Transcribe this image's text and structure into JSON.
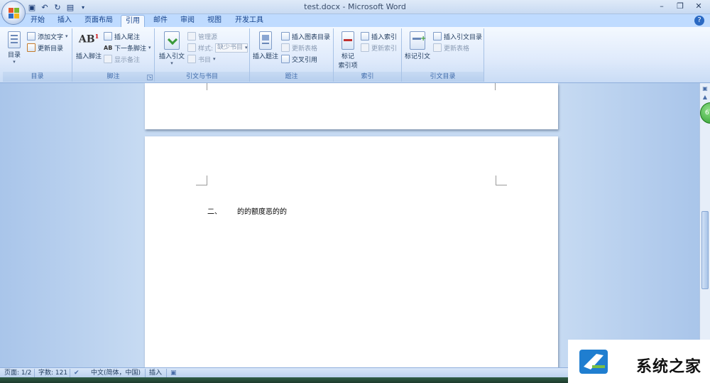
{
  "window": {
    "title": "test.docx - Microsoft Word"
  },
  "quick_access": [
    "save-icon",
    "undo-icon",
    "redo-icon",
    "print-preview-icon"
  ],
  "tabs": [
    {
      "label": "开始"
    },
    {
      "label": "插入"
    },
    {
      "label": "页面布局"
    },
    {
      "label": "引用",
      "active": true
    },
    {
      "label": "邮件"
    },
    {
      "label": "审阅"
    },
    {
      "label": "视图"
    },
    {
      "label": "开发工具"
    }
  ],
  "ribbon": {
    "toc": {
      "label": "目录",
      "big_button": "目录",
      "add_text": "添加文字",
      "update_toc": "更新目录"
    },
    "footnotes": {
      "label": "脚注",
      "insert_footnote": "插入脚注",
      "insert_endnote": "插入尾注",
      "next_footnote": "下一条脚注",
      "show_notes": "显示备注",
      "icon_text": "AB",
      "icon_sup": "1",
      "next_icon_text": "AB"
    },
    "citations": {
      "label": "引文与书目",
      "insert_citation": "插入引文",
      "manage_sources": "管理源",
      "style_label": "样式:",
      "style_value": "缺少书目",
      "bibliography": "书目"
    },
    "captions": {
      "label": "题注",
      "insert_caption": "插入题注",
      "insert_table_of_figures": "插入图表目录",
      "update_table": "更新表格",
      "cross_reference": "交叉引用"
    },
    "index": {
      "label": "索引",
      "mark_entry_line1": "标记",
      "mark_entry_line2": "索引项",
      "insert_index": "插入索引",
      "update_index": "更新索引"
    },
    "toa": {
      "label": "引文目录",
      "mark_citation": "标记引文",
      "insert_toa": "插入引文目录",
      "update_table": "更新表格"
    }
  },
  "document": {
    "heading_number": "二、",
    "heading_text": "的的额度恶的的"
  },
  "statusbar": {
    "page": "页面: 1/2",
    "words": "字数: 121",
    "language": "中文(简体，中国)",
    "mode": "插入"
  },
  "zoom_badge": "67",
  "watermark": {
    "text": "系统之家"
  },
  "colors": {
    "ribbon_tab_text": "#15428b",
    "doc_background": "#c6daf2"
  }
}
